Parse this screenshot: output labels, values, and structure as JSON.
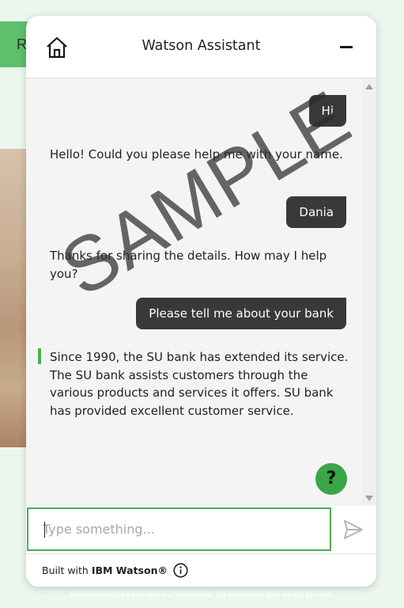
{
  "background": {
    "pill_label": "R",
    "processed_notice": "Processed using the free version of Watermarkly. The paid version does not add this mark."
  },
  "header": {
    "title": "Watson Assistant",
    "home_icon": "home-icon",
    "minimize_icon": "minimize-icon"
  },
  "messages": [
    {
      "from": "user",
      "text": "Hi"
    },
    {
      "from": "bot",
      "text": "Hello! Could you please help me with your name."
    },
    {
      "from": "user",
      "text": "Dania"
    },
    {
      "from": "bot",
      "text": "Thanks for sharing the details. How may I help you?"
    },
    {
      "from": "user",
      "text": "Please tell me about your bank"
    },
    {
      "from": "bot",
      "text": "Since 1990, the SU bank has extended its service. The SU bank assists customers through the various products and services it offers. SU bank has provided excellent customer service."
    }
  ],
  "help_button": {
    "label": "?"
  },
  "input": {
    "placeholder": "Type something...",
    "value": ""
  },
  "footer": {
    "built_with": "Built with",
    "brand": "IBM Watson®"
  },
  "watermark": {
    "text": "SAMPLE"
  },
  "colors": {
    "accent": "#4caf50",
    "user_bubble": "#393939",
    "help": "#3aa64a"
  }
}
